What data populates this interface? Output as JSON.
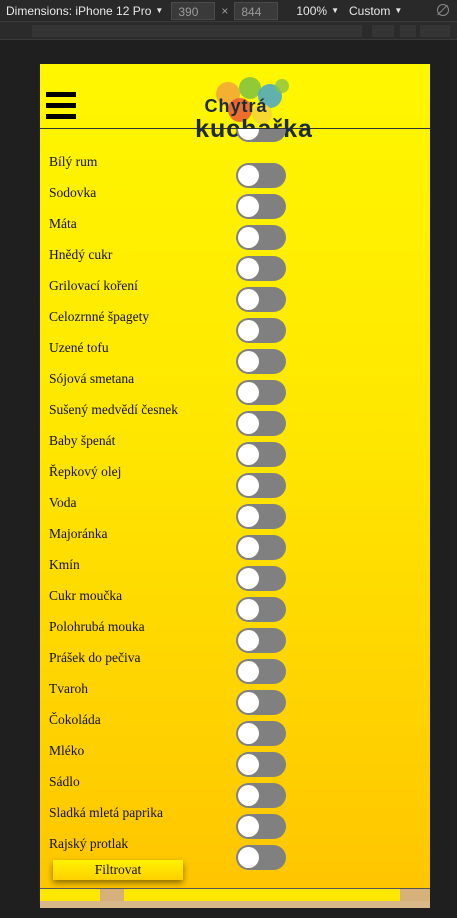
{
  "devtools": {
    "device_label": "Dimensions: iPhone 12 Pro",
    "width_value": "390",
    "times": "×",
    "height_value": "844",
    "zoom": "100%",
    "throttle": "Custom"
  },
  "app": {
    "logo_line1": "Chytrá",
    "logo_line2": "kuchařka"
  },
  "ingredients": [
    {
      "name": "",
      "checked": false
    },
    {
      "name": "Bílý rum",
      "checked": false
    },
    {
      "name": "Sodovka",
      "checked": false
    },
    {
      "name": "Máta",
      "checked": false
    },
    {
      "name": "Hnědý cukr",
      "checked": false
    },
    {
      "name": "Grilovací koření",
      "checked": false
    },
    {
      "name": "Celozrnné špagety",
      "checked": false
    },
    {
      "name": "Uzené tofu",
      "checked": false
    },
    {
      "name": "Sójová smetana",
      "checked": false
    },
    {
      "name": "Sušený medvědí česnek",
      "checked": false
    },
    {
      "name": "Baby špenát",
      "checked": false
    },
    {
      "name": "Řepkový olej",
      "checked": false
    },
    {
      "name": "Voda",
      "checked": false
    },
    {
      "name": "Majoránka",
      "checked": false
    },
    {
      "name": "Kmín",
      "checked": false
    },
    {
      "name": "Cukr moučka",
      "checked": false
    },
    {
      "name": "Polohrubá mouka",
      "checked": false
    },
    {
      "name": "Prášek do pečiva",
      "checked": false
    },
    {
      "name": "Tvaroh",
      "checked": false
    },
    {
      "name": "Čokoláda",
      "checked": false
    },
    {
      "name": "Mléko",
      "checked": false
    },
    {
      "name": "Sádlo",
      "checked": false
    },
    {
      "name": "Sladká mletá paprika",
      "checked": false
    },
    {
      "name": "Rajský protlak",
      "checked": false
    }
  ],
  "filter_label": "Filtrovat",
  "colors": {
    "toggle_off": "#808080",
    "accent": "#ffe600",
    "logo_text": "#1e2b3a"
  }
}
